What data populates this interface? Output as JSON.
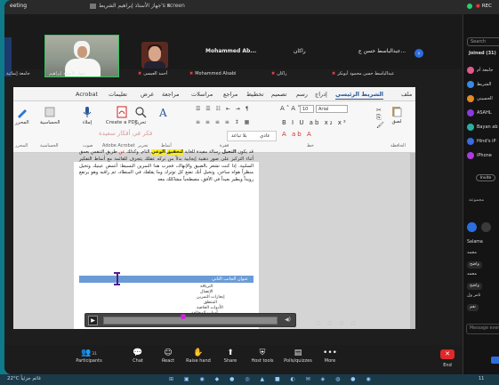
{
  "titlebar": {
    "meeting_name": "eeting",
    "share_label": "جهاز الأستاذ إبراهيم الشريط's screen",
    "rec_label": "REC"
  },
  "participants_strip": {
    "tiles": [
      {
        "name": "Mohammed Ab..."
      },
      {
        "name": "راكان"
      },
      {
        "name": "عبدالباسط حسن ع..."
      }
    ],
    "name_tags": [
      {
        "name": "جامعة إنمائية"
      },
      {
        "name": "جهاز الأستاذ إبراهيم"
      },
      {
        "name": "أحمد العيسى"
      },
      {
        "name": "Mohammed Alsabi"
      },
      {
        "name": "راكان"
      },
      {
        "name": "عبدالباسط حسن محمود أبوبكر"
      },
      {
        "name": "عبدالباسط حسن ع"
      }
    ]
  },
  "word": {
    "tabs": [
      "ملف",
      "الشريط الرئيسي",
      "إدراج",
      "رسم",
      "تصميم",
      "تخطيط",
      "مراجع",
      "مراسلات",
      "مراجعة",
      "عرض",
      "تعليمات",
      "Acrobat"
    ],
    "active_tab": "الشريط الرئيسي",
    "font_name": "Arial",
    "font_size": "10",
    "style_name": "عادي",
    "style_name_2": "بلا تباعد",
    "groups": {
      "clipboard": "الحافظة",
      "font": "خط",
      "paragraph": "فقرة",
      "styles": "أنماط",
      "editing": "تحرير",
      "acrobat": "Adobe Acrobat",
      "voice": "صوت",
      "sensitivity": "الحساسية",
      "editor": "المحرر"
    },
    "buttons": {
      "paste": "لصق",
      "create_pdf": "Create a PDF",
      "dictate": "إملاء",
      "editing": "تحرير",
      "sensitivity": "الحساسية",
      "editor": "المحرر"
    },
    "document": {
      "heading": "فكر في أفكار سعيدة",
      "paragraph_before": "قد يكون",
      "bold_word": "التخيل",
      "paragraph_mid": "رسالة مفيدة للغاية",
      "highlight_1": "لتحقيق",
      "highlight_2": "الوعي",
      "paragraph_rest_1": "التام. وكذلك",
      "red_word": "عن",
      "paragraph_rest_2": "طريق التنفس بعمق أثناء التركيز على صور ذهنية إيجابية بدلاً من تركه عقلك يتجرف للقائمة مع أنماط التفكير السلبية. إذا كنت تشعر بالضيق والإنهاك، فجرب هذا التمرين البسيط: أغمض عينيك وتخيل منظراً هواه ساخن. وتخيل أنك تضع كل توترك وما يقلقك في المنطاد، ثم راقبه وهو يرتفع رويداً ويطير بعيداً في الأفق، مصطحباً مشاكلك معه",
      "selected_heading": "عنوان الجانب الثاني",
      "toc_items": [
        "الترياقة",
        "الإتصال",
        "إنجازات التمرين",
        "المنطق",
        "الأدوات الخاصة",
        "أدوات المخالفة",
        "التحكم"
      ]
    }
  },
  "player": {
    "progress_fraction": 0.45
  },
  "toolbar": {
    "items": [
      {
        "label": "Participants",
        "count": "31",
        "icon": "participants-icon"
      },
      {
        "label": "Chat",
        "icon": "chat-icon"
      },
      {
        "label": "React",
        "icon": "react-icon"
      },
      {
        "label": "Raise hand",
        "icon": "raise-hand-icon"
      },
      {
        "label": "Share",
        "icon": "share-icon"
      },
      {
        "label": "Host tools",
        "icon": "host-tools-icon"
      },
      {
        "label": "Polls/quizzes",
        "icon": "polls-icon"
      },
      {
        "label": "More",
        "icon": "more-icon"
      }
    ],
    "end_label": "End"
  },
  "right_panel": {
    "search_placeholder": "Search",
    "joined_label": "Joined (31)",
    "people": [
      {
        "name": "جامعة أم",
        "color": "#e05a8c"
      },
      {
        "name": "الشريط",
        "color": "#3a8be0"
      },
      {
        "name": "الحسيني",
        "color": "#e08a2a"
      },
      {
        "name": "ASAHL",
        "color": "#8a3ae0"
      },
      {
        "name": "Bayan ab",
        "color": "#2ab0a0"
      },
      {
        "name": "Hind's iP",
        "color": "#3a6be0"
      },
      {
        "name": "iPhone",
        "color": "#b03ae0"
      }
    ],
    "invite_label": "Invite",
    "chat_header": "مجموعة",
    "chat_lines": [
      {
        "text": "Salama",
        "type": "label"
      },
      {
        "text": "محمد",
        "type": "label"
      },
      {
        "text": "واضح",
        "type": "bubble"
      },
      {
        "text": "محمد",
        "type": "label"
      },
      {
        "text": "واضح",
        "type": "bubble"
      },
      {
        "text": "ثامر ول",
        "type": "label"
      },
      {
        "text": "نعم",
        "type": "bubble"
      }
    ],
    "message_placeholder": "Message every"
  },
  "taskbar": {
    "weather": "22°C غائم جزئياً",
    "clock": "11"
  },
  "colors": {
    "frame": "#0f7a8a",
    "zoom_bg": "#1e1e1e",
    "accent_blue": "#2d6de0",
    "word_blue": "#2b579a",
    "end_red": "#e02828",
    "highlight": "#fff200"
  }
}
